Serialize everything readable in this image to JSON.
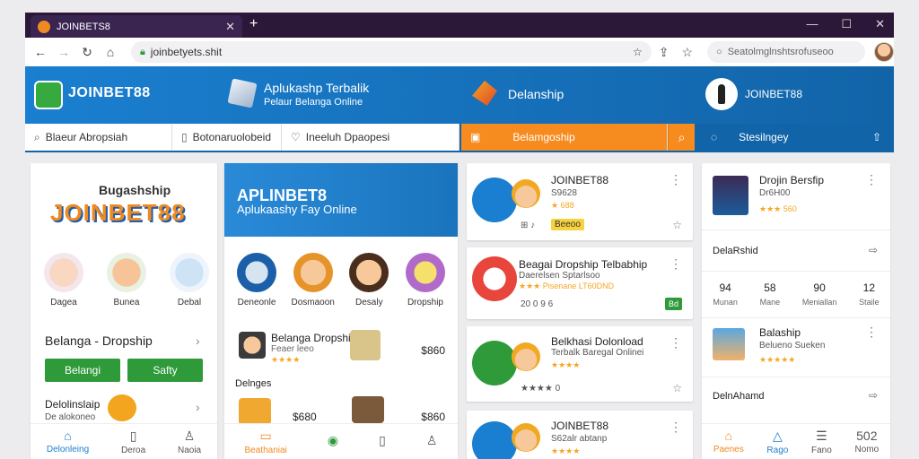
{
  "browser": {
    "tab_title": "JOINBETS8",
    "url": "joinbetyets.shit",
    "address_search": "Seatolmglnshtsrofuseoo"
  },
  "hero": {
    "logo": "JOINBET88",
    "title": "Aplukashp Terbalik",
    "subtitle": "Pelaur Belanga Online",
    "category": "Delanship",
    "profile": "JOINBET88"
  },
  "strip": {
    "seg1": "Blaeur Abropsiah",
    "seg2": "Botonaruolobeid",
    "seg3": "Ineeluh Dpaopesi",
    "seg4": "Belamgoship",
    "right": "Stesilngey"
  },
  "panel1": {
    "brand_small": "Bugashship",
    "brand_big": "JOINBET88",
    "categories": [
      "Dagea",
      "Bunea",
      "Debal"
    ],
    "heading": "Belanga - Dropship",
    "btn1": "Belangi",
    "btn2": "Safty",
    "item_title": "Delolinslaip",
    "item_sub": "De alokoneo",
    "nav": [
      "Delonleing",
      "Deroa",
      "Naoia"
    ]
  },
  "panel2": {
    "banner_t1": "APLINBET8",
    "banner_t2": "Aplukaashy Fay Online",
    "categories": [
      "Deneonle",
      "Dosmaoon",
      "Desaly",
      "Dropship"
    ],
    "row1": {
      "title": "Belanga Dropship",
      "sub": "Feaer leeo",
      "price": "$860"
    },
    "label": "Delnges",
    "row2": {
      "price1": "$680",
      "price2": "$860"
    },
    "nav": [
      "Beathaniai"
    ]
  },
  "cards": [
    {
      "title": "JOINBET88",
      "sub": "S9628",
      "stars": "★ 688",
      "tag": "Beeoo"
    },
    {
      "title": "Beagai Dropship Telbabhip",
      "sub": "Daerelsen Sptarlsoo",
      "stars": "★★★ Pisenane LT60DND",
      "badge": "Bd",
      "meta": "20 0 9 6"
    },
    {
      "title": "Belkhasi Dolonload",
      "sub": "Terbalk Baregal Onlinei",
      "stars": "★★★★",
      "meta": "★★★★ 0"
    },
    {
      "title": "JOINBET88",
      "sub": "S62alr abtanp",
      "stars": "★★★★"
    }
  ],
  "panel4": {
    "item1": {
      "title": "Drojin Bersfip",
      "sub": "Dr6H00",
      "stars": "★★★ 560"
    },
    "label1": "DelaRshid",
    "stats": [
      {
        "n": "94",
        "l": "Munan"
      },
      {
        "n": "58",
        "l": "Mane"
      },
      {
        "n": "90",
        "l": "Meniallan"
      },
      {
        "n": "12",
        "l": "Staile"
      }
    ],
    "item2": {
      "title": "Balaship",
      "sub": "Belueno Sueken",
      "stars": "★★★★★"
    },
    "label2": "DelnAhamd",
    "nav": [
      "Paenes",
      "Rago",
      "Fano",
      "Nomo"
    ],
    "nav_count": "502"
  }
}
